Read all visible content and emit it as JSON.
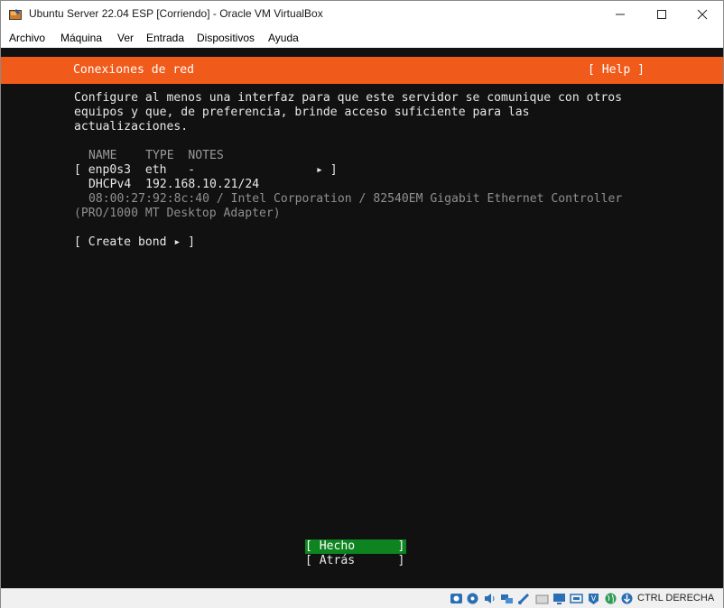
{
  "window": {
    "title": "Ubuntu Server 22.04 ESP [Corriendo] - Oracle VM VirtualBox",
    "menu": [
      "Archivo",
      "Máquina",
      "Ver",
      "Entrada",
      "Dispositivos",
      "Ayuda"
    ]
  },
  "installer": {
    "header_title": "Conexiones de red",
    "help_label": "[ Help ]",
    "description": [
      "Configure al menos una interfaz para que este servidor se comunique con otros",
      "equipos y que, de preferencia, brinde acceso suficiente para las",
      "actualizaciones."
    ],
    "table_headers": "NAME    TYPE  NOTES",
    "interface_row": "[ enp0s3  eth   -                 ▸ ]",
    "dhcp_row": "DHCPv4  192.168.10.21/24",
    "hw_line1": "08:00:27:92:8c:40 / Intel Corporation / 82540EM Gigabit Ethernet Controller",
    "hw_line2": "(PRO/1000 MT Desktop Adapter)",
    "create_bond": "[ Create bond ▸ ]",
    "done_button": "[ Hecho      ]",
    "back_button": "[ Atrás      ]"
  },
  "statusbar": {
    "host_key": "CTRL DERECHA",
    "icons": [
      "hdd-icon",
      "optical-icon",
      "audio-icon",
      "network-icon",
      "usb-icon",
      "shared-folder-icon",
      "display-icon",
      "recording-icon",
      "vt-x-icon",
      "globe-icon",
      "mouse-integration-icon"
    ]
  },
  "colors": {
    "header_orange": "#f05a1a",
    "selected_green": "#0e8420",
    "terminal_bg": "#111111"
  }
}
